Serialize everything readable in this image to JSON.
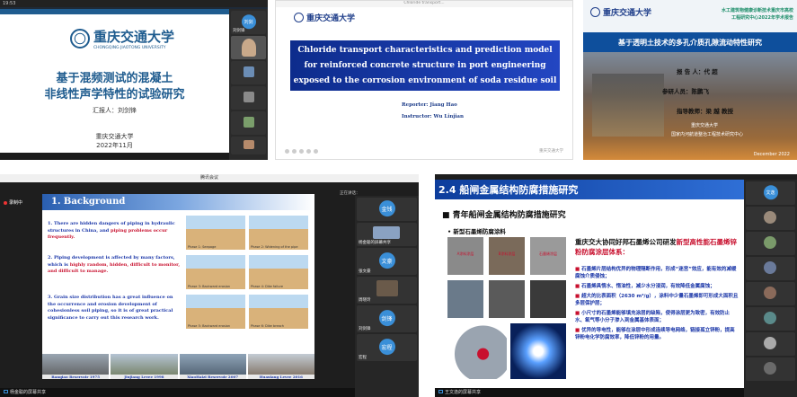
{
  "s1": {
    "title_bar": "19:53",
    "logo_text": "重庆交通大学",
    "logo_sub": "CHONGQING JIAOTONG UNIVERSITY",
    "title1": "基于混频测试的混凝土",
    "title2": "非线性声学特性的试验研究",
    "reporter": "汇报人：刘剑锋",
    "school": "重庆交通大学",
    "date": "2022年11月",
    "participants": [
      {
        "name": "刘剑锋",
        "badge": "刘剑",
        "color": "#3a8fd8"
      },
      {
        "name": "",
        "color": ""
      },
      {
        "name": "",
        "color": ""
      },
      {
        "name": "",
        "color": ""
      },
      {
        "name": "",
        "color": ""
      },
      {
        "name": "",
        "color": ""
      }
    ]
  },
  "s2": {
    "toolbar": "Chloride transport...",
    "logo_text": "重庆交通大学",
    "title_lines": [
      "Chloride transport characteristics and prediction model",
      "for reinforced concrete structure in port engineering",
      "exposed to the corrosion environment of soda residue soil"
    ],
    "reporter": "Reporter: Jiang Hao",
    "instructor": "Instructor: Wu Linjian",
    "footer": "重庆交通大学"
  },
  "s3": {
    "logo_text": "重庆交通大学",
    "header_right1": "水工建筑物健康诊断技术重庆市高校",
    "header_right2": "工程研究中心2022年学术报告",
    "title": "基于透明土技术的多孔介质孔隙流动特性研究",
    "reporter": "报 告 人：代 超",
    "participant": "参研人员：陈鹏飞",
    "advisor": "指导教师：梁 越 教授",
    "school": "重庆交通大学",
    "center": "国家内河航道整治工程技术研究中心",
    "date": "December 2022"
  },
  "s4": {
    "window_title": "腾讯会议",
    "recording": "录制中",
    "speaking": "正在讲话：",
    "slide_title": "1. Background",
    "items": [
      {
        "num": "1.",
        "text": "There are hidden dangers of piping in hydraulic structures in China, and",
        "highlight": "piping problems occur frequently."
      },
      {
        "num": "2.",
        "text": "Piping development is affected by many factors, which is",
        "highlight": "highly random, hidden, difficult to monitor, and difficult to manage."
      },
      {
        "num": "3.",
        "text": "Grain size distribution has a great influence on the occurrence and erosion development of cohesionless soil piping, so it is of great practical significance to carry out this research work.",
        "highlight": ""
      }
    ],
    "phases": [
      "Phase 1: Seepage",
      "Phase 2: Widening of the pipe",
      "Phase 3: Backward erosion",
      "Phase 4: Dike failure",
      "Phase 5: Backward erosion",
      "Phase 6: Dike breach"
    ],
    "photos": [
      "Banqiao Reservoir 1975",
      "Jiujiang Levee 1998",
      "XiaoHaizi Reservoir 2007",
      "Huaxiang Levee 2016"
    ],
    "presenter_bar": "杨金聪的屏幕共享",
    "participants": [
      {
        "badge": "金钱",
        "color": "#3a8fd8",
        "name": ""
      },
      {
        "badge": "",
        "color": "",
        "name": "杨金聪的屏幕共享"
      },
      {
        "badge": "文豪",
        "color": "#3a8fd8",
        "name": "张文豪"
      },
      {
        "badge": "",
        "color": "",
        "name": "周晓玲"
      },
      {
        "badge": "剑锋",
        "color": "#3a8fd8",
        "name": "刘剑锋"
      },
      {
        "badge": "宏程",
        "color": "#3a8fd8",
        "name": "宏程"
      }
    ]
  },
  "s5": {
    "header_title": "2.4 船闸金属结构防腐措施研究",
    "subtitle": "■ 青年船闸金属结构防腐措施研究",
    "section": "• 新型石墨烯防腐涂料",
    "intro1": "重庆交大协同好邦石墨烯公司研发",
    "intro_highlight": "新型高性能石墨烯锌粉防腐涂层体系：",
    "bullets": [
      "石墨烯片层结构优异的物理隔断作用，形成“迷宫”效应，能有效的减缓腐蚀介质侵蚀；",
      "石墨烯具惰水、惰油性，减少水分浸润，有效降低金属腐蚀；",
      "超大的比表面积（2630 m²/g），涂料中少量石墨烯即可形成大面积且多层保护层；",
      "小尺寸的石墨烯能够填充涂层的缺陷，使得涂层更为致密，有效防止水、氧气等小分子渗入到金属基体表面；",
      "优异的导电性，能够在涂层中形成连续导电网络，链接孤立锌粉，提高锌粉电化学防腐效率，降低锌粉的用量。"
    ],
    "sample_labels": [
      "A涂料涂层",
      "B涂料涂层",
      "石墨烯涂层"
    ],
    "presenter_bar": "王文逸的屏幕共享",
    "participants": [
      {
        "badge": "文逸",
        "color": "#3a8fd8",
        "name": ""
      },
      {
        "badge": "",
        "color": "",
        "name": ""
      },
      {
        "badge": "",
        "color": "",
        "name": ""
      },
      {
        "badge": "",
        "color": "",
        "name": ""
      },
      {
        "badge": "",
        "color": "",
        "name": ""
      },
      {
        "badge": "",
        "color": "",
        "name": ""
      },
      {
        "badge": "",
        "color": "",
        "name": ""
      },
      {
        "badge": "",
        "color": "",
        "name": ""
      }
    ]
  }
}
